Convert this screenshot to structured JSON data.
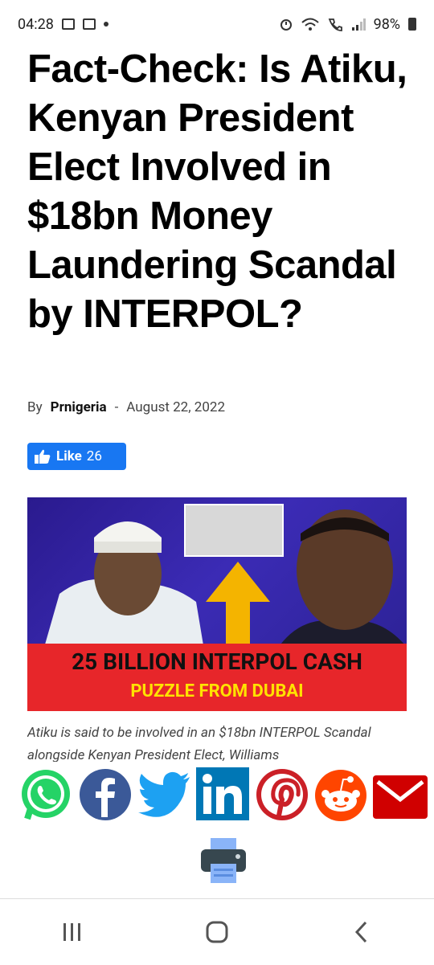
{
  "status_bar": {
    "time": "04:28",
    "battery": "98%"
  },
  "article": {
    "title": "Fact-Check: Is Atiku, Kenyan President Elect Involved in $18bn Money Laundering Scandal by INTERPOL?",
    "byline_prefix": "By",
    "author": "Prnigeria",
    "separator": "-",
    "date": "August 22, 2022",
    "like_label": "Like",
    "like_count": "26",
    "image_text_line1": "25 BILLION INTERPOL CASH",
    "image_text_line2": "PUZZLE FROM DUBAI",
    "caption": "Atiku is said to be involved in an $18bn INTERPOL Scandal alongside Kenyan President Elect, Williams"
  },
  "share": {
    "icons": [
      "whatsapp-icon",
      "facebook-icon",
      "twitter-icon",
      "linkedin-icon",
      "pinterest-icon",
      "reddit-icon",
      "email-icon"
    ],
    "print_icon": "printer-icon"
  },
  "colors": {
    "like_blue": "#1877f2",
    "whatsapp": "#25d366",
    "facebook": "#3b5998",
    "twitter": "#1da1f2",
    "linkedin": "#0077b5",
    "pinterest": "#cb2027",
    "reddit": "#ff4500",
    "email": "#d00000"
  }
}
